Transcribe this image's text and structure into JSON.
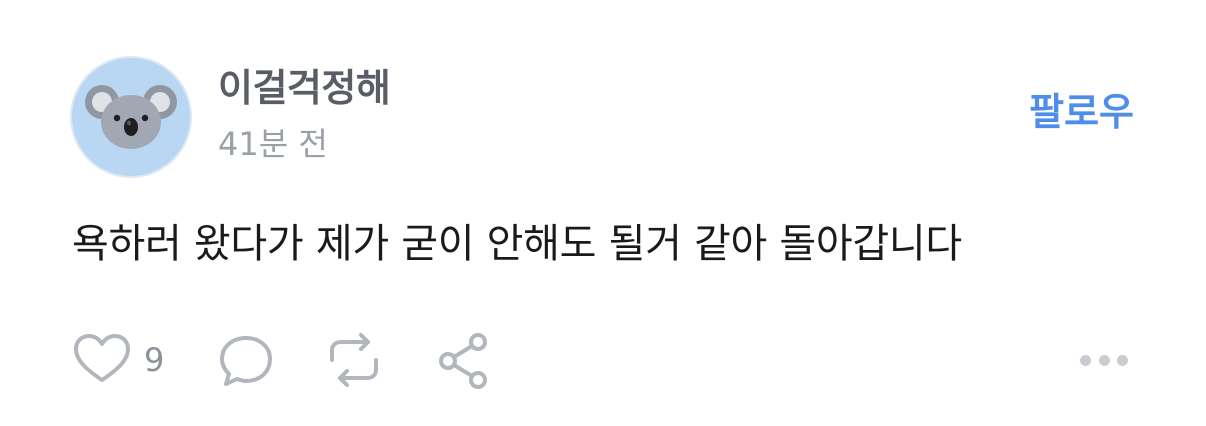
{
  "post": {
    "author": "이걸걱정해",
    "timestamp": "41분 전",
    "follow_label": "팔로우",
    "text": "욕하러 왔다가 제가 굳이 안해도 될거 같아 돌아갑니다",
    "avatar_icon": "koala-avatar-icon"
  },
  "actions": {
    "like_count": "9",
    "like_icon": "heart-icon",
    "comment_icon": "comment-bubble-icon",
    "repost_icon": "repost-icon",
    "share_icon": "share-icon",
    "more_icon": "more-dots-icon"
  },
  "colors": {
    "follow": "#4f8ee8",
    "author": "#585d66",
    "muted": "#9aa0a8",
    "icon": "#b2b6bd",
    "avatar_bg": "#b9d7f3"
  }
}
